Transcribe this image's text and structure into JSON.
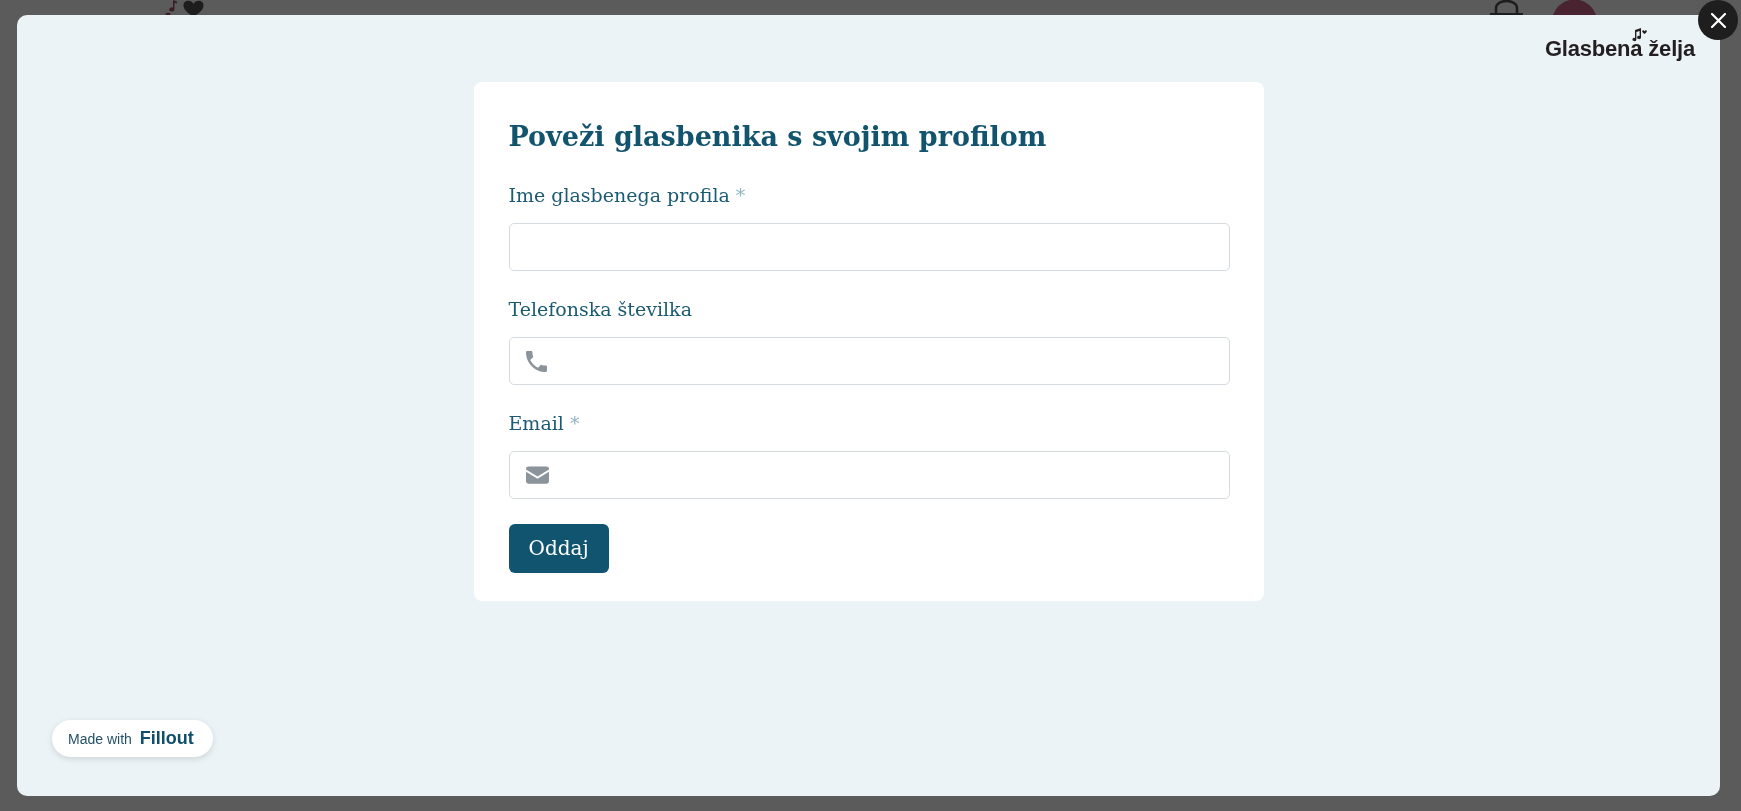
{
  "logo": {
    "text": "Glasbena želja"
  },
  "form": {
    "title": "Poveži glasbenika s svojim profilom",
    "fields": [
      {
        "kind": "text",
        "label": "Ime glasbenega profila",
        "required_mark": "*"
      },
      {
        "kind": "phone",
        "label": "Telefonska številka"
      },
      {
        "kind": "email",
        "label": "Email",
        "required_mark": "*"
      }
    ],
    "submit_button": "Oddaj"
  },
  "badge": {
    "prefix": "Made with",
    "brand": "Fillout"
  }
}
